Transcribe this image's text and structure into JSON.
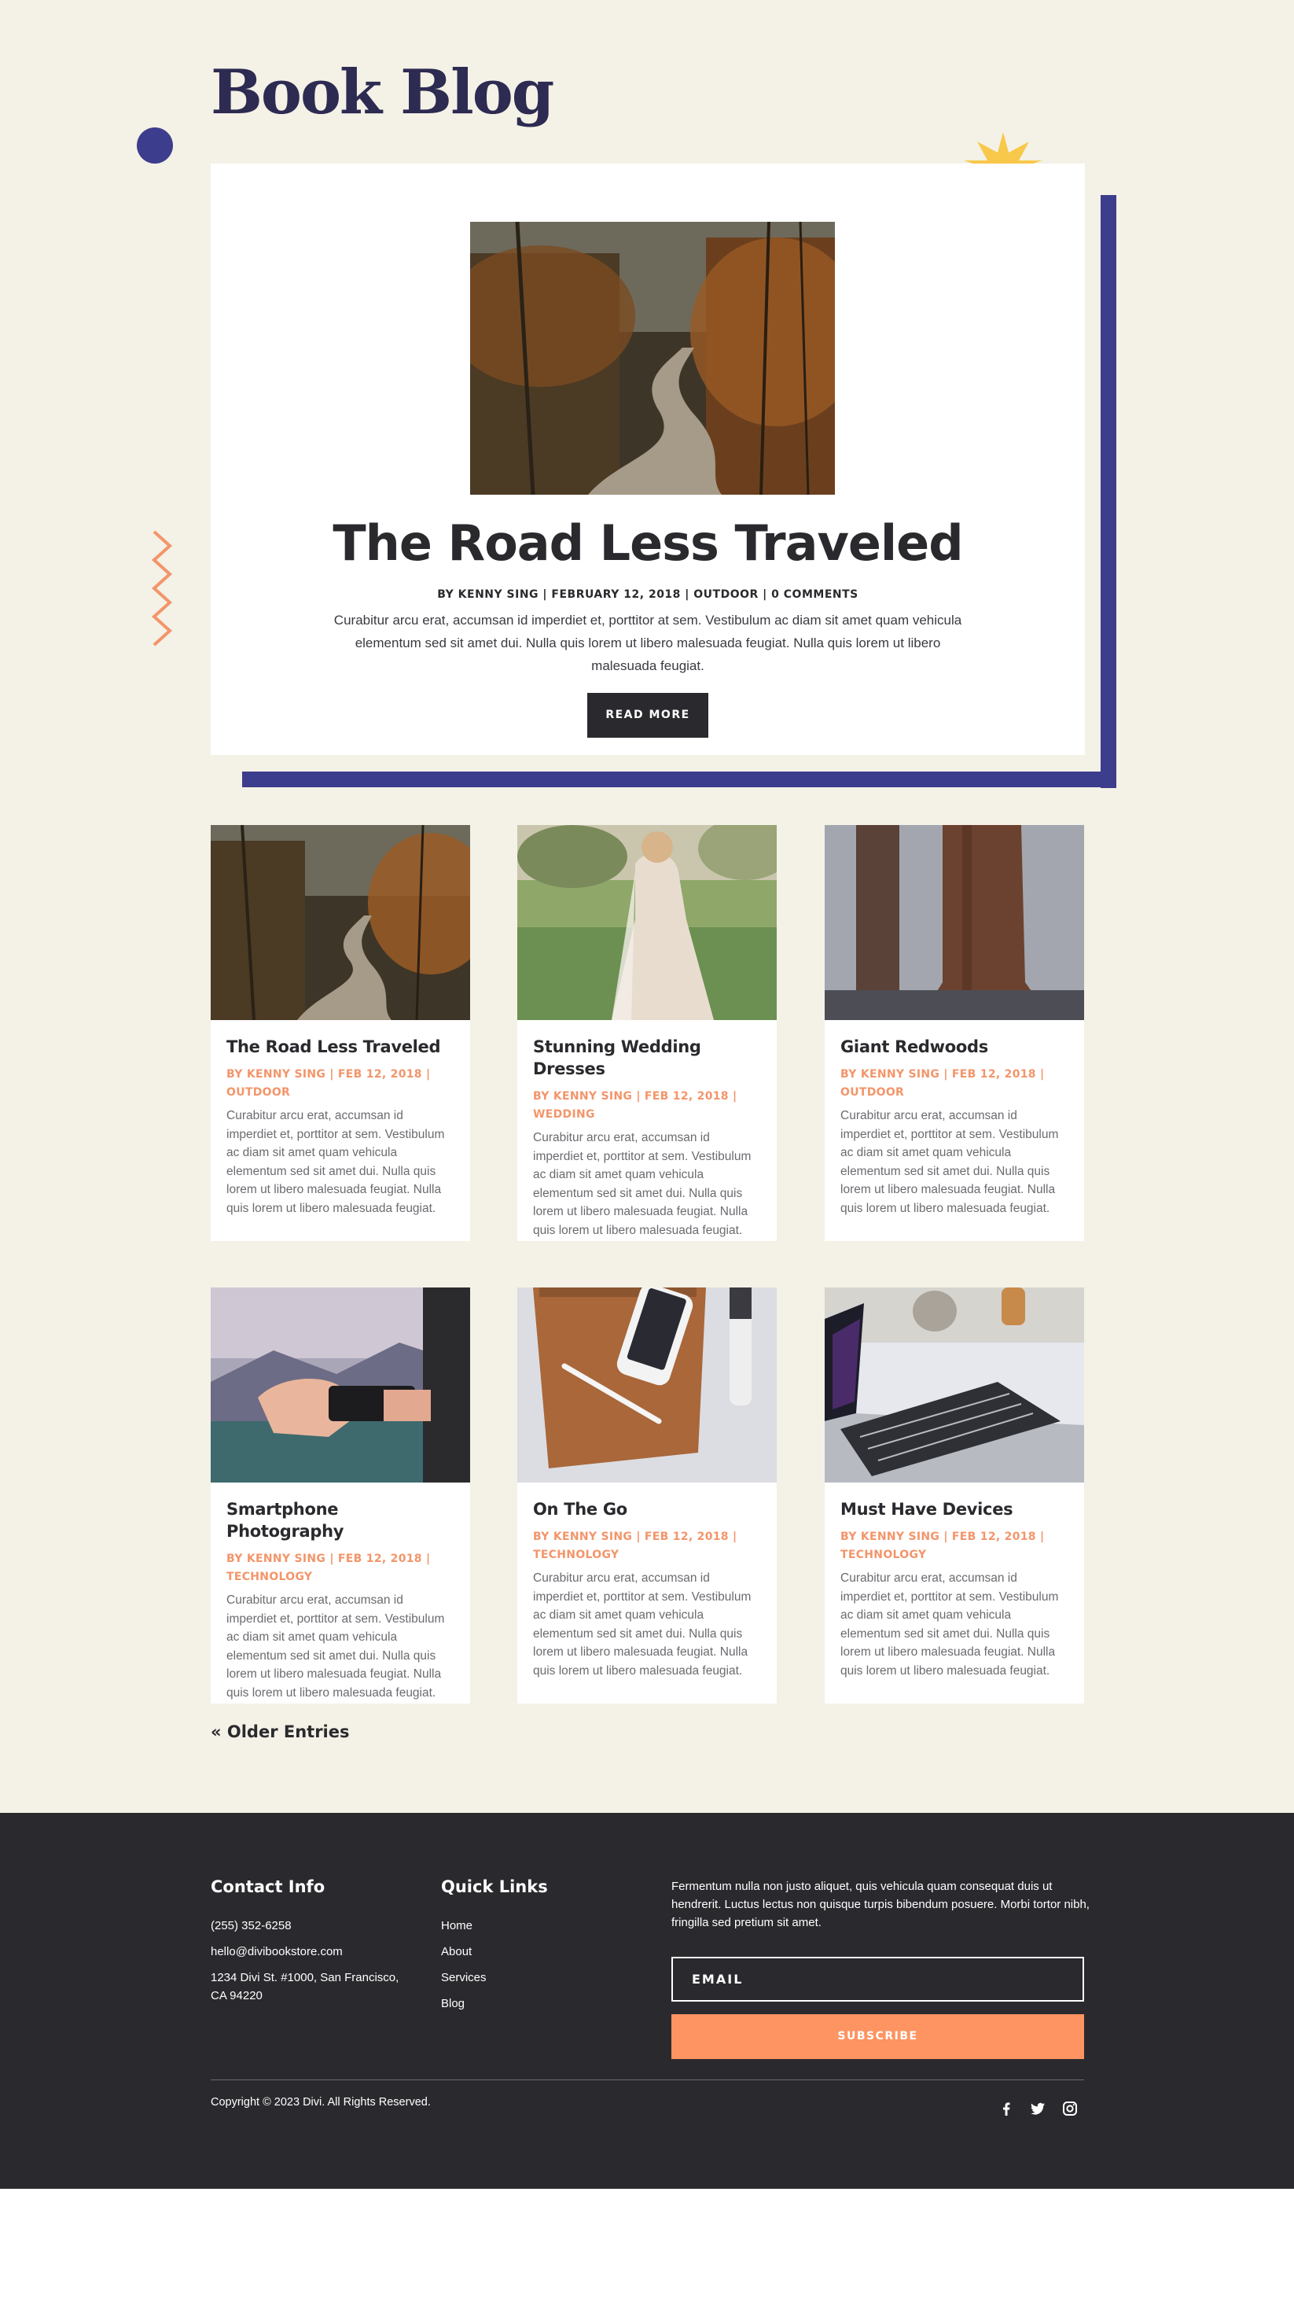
{
  "page": {
    "title": "Book Blog"
  },
  "featured": {
    "title": "The Road Less Traveled",
    "meta": "BY KENNY SING | FEBRUARY 12, 2018 | OUTDOOR | 0 COMMENTS",
    "excerpt": "Curabitur arcu erat, accumsan id imperdiet et, porttitor at sem. Vestibulum ac diam sit amet quam vehicula elementum sed sit amet dui. Nulla quis lorem ut libero malesuada feugiat. Nulla quis lorem ut libero malesuada feugiat.",
    "button_label": "READ MORE"
  },
  "posts": [
    {
      "title": "The Road Less Traveled",
      "meta": "BY KENNY SING | FEB 12, 2018 | OUTDOOR",
      "excerpt": "Curabitur arcu erat, accumsan id imperdiet et, porttitor at sem. Vestibulum ac diam sit amet quam vehicula elementum sed sit amet dui. Nulla quis lorem ut libero malesuada feugiat. Nulla quis lorem ut libero malesuada feugiat."
    },
    {
      "title": "Stunning Wedding Dresses",
      "meta": "BY KENNY SING | FEB 12, 2018 | WEDDING",
      "excerpt": "Curabitur arcu erat, accumsan id imperdiet et, porttitor at sem. Vestibulum ac diam sit amet quam vehicula elementum sed sit amet dui. Nulla quis lorem ut libero malesuada feugiat. Nulla quis lorem ut libero malesuada feugiat."
    },
    {
      "title": "Giant Redwoods",
      "meta": "BY KENNY SING | FEB 12, 2018 | OUTDOOR",
      "excerpt": "Curabitur arcu erat, accumsan id imperdiet et, porttitor at sem. Vestibulum ac diam sit amet quam vehicula elementum sed sit amet dui. Nulla quis lorem ut libero malesuada feugiat. Nulla quis lorem ut libero malesuada feugiat."
    },
    {
      "title": "Smartphone Photography",
      "meta": "BY KENNY SING | FEB 12, 2018 | TECHNOLOGY",
      "excerpt": "Curabitur arcu erat, accumsan id imperdiet et, porttitor at sem. Vestibulum ac diam sit amet quam vehicula elementum sed sit amet dui. Nulla quis lorem ut libero malesuada feugiat. Nulla quis lorem ut libero malesuada feugiat."
    },
    {
      "title": "On The Go",
      "meta": "BY KENNY SING | FEB 12, 2018 | TECHNOLOGY",
      "excerpt": "Curabitur arcu erat, accumsan id imperdiet et, porttitor at sem. Vestibulum ac diam sit amet quam vehicula elementum sed sit amet dui. Nulla quis lorem ut libero malesuada feugiat. Nulla quis lorem ut libero malesuada feugiat."
    },
    {
      "title": "Must Have Devices",
      "meta": "BY KENNY SING | FEB 12, 2018 | TECHNOLOGY",
      "excerpt": "Curabitur arcu erat, accumsan id imperdiet et, porttitor at sem. Vestibulum ac diam sit amet quam vehicula elementum sed sit amet dui. Nulla quis lorem ut libero malesuada feugiat. Nulla quis lorem ut libero malesuada feugiat."
    }
  ],
  "pagination": {
    "older_label": "« Older Entries"
  },
  "footer": {
    "contact_heading": "Contact Info",
    "phone": "(255) 352-6258",
    "email": "hello@divibookstore.com",
    "address_line1": "1234 Divi St. #1000, San Francisco,",
    "address_line2": "CA 94220",
    "links_heading": "Quick Links",
    "links": [
      "Home",
      "About",
      "Services",
      "Blog"
    ],
    "newsletter_text": "Fermentum nulla non justo aliquet, quis vehicula quam consequat duis ut hendrerit. Luctus lectus non quisque turpis bibendum posuere. Morbi tortor nibh, fringilla sed pretium sit amet.",
    "email_placeholder": "EMAIL",
    "subscribe_label": "SUBSCRIBE",
    "copyright": "Copyright © 2023 Divi. All Rights Reserved.",
    "social_icons": [
      "facebook-icon",
      "twitter-icon",
      "instagram-icon"
    ]
  },
  "colors": {
    "background": "#f4f1e6",
    "navy": "#3c3d8c",
    "title": "#2d2b52",
    "accent_orange": "#fe9461",
    "meta_orange": "#f3956a",
    "dark": "#2a2a2e",
    "star_yellow": "#f8c84a"
  }
}
